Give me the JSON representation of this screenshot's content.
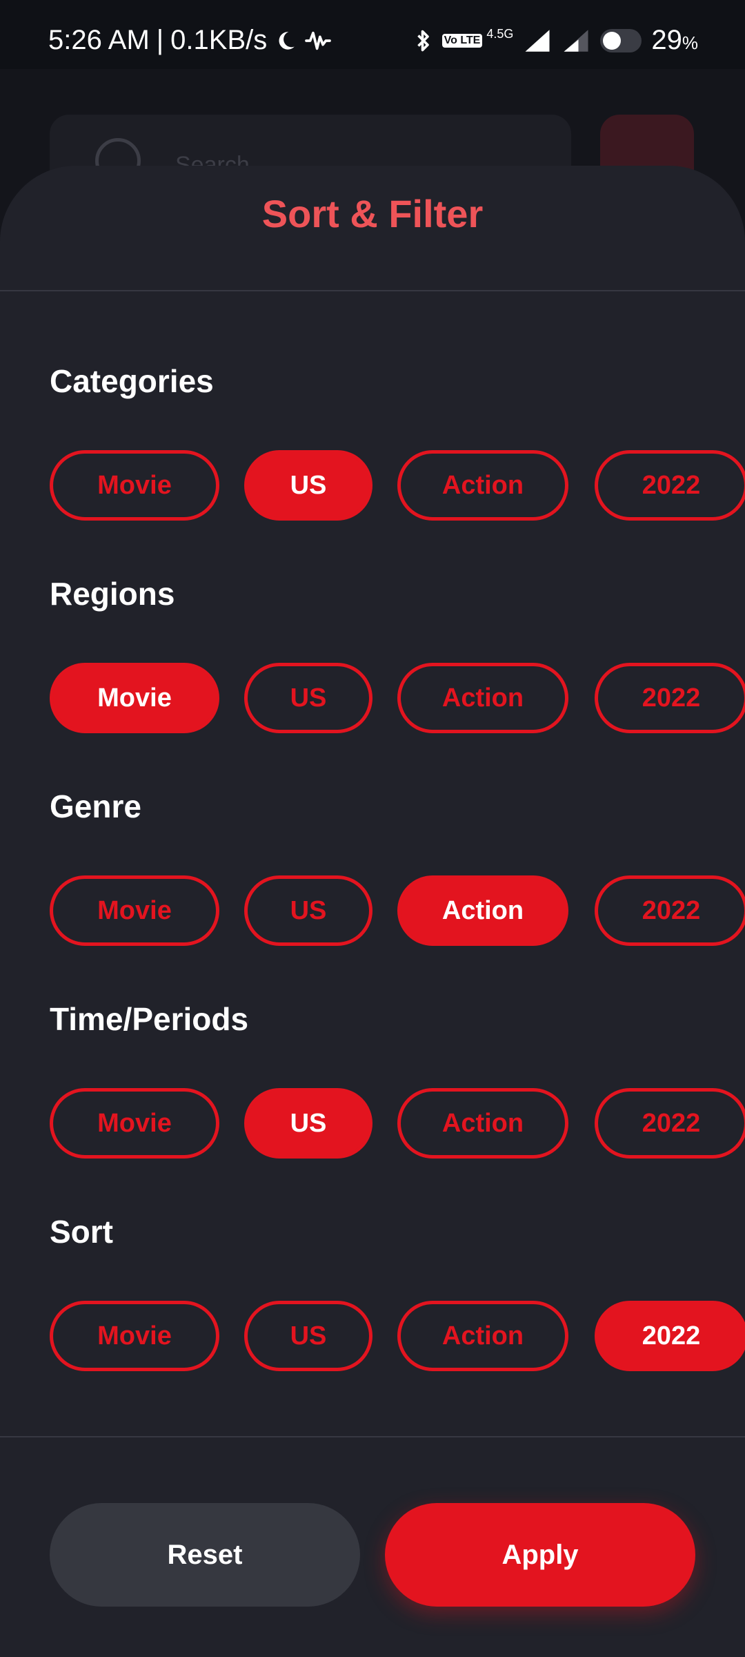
{
  "status_bar": {
    "time": "5:26 AM",
    "separator": "|",
    "net_speed": "0.1KB/s",
    "network_type": "4.5G",
    "volte": "Vo LTE",
    "battery": "29",
    "battery_unit": "%"
  },
  "background": {
    "search_placeholder": "Search"
  },
  "sheet": {
    "title": "Sort & Filter",
    "sections": [
      {
        "title": "Categories",
        "chips": [
          {
            "label": "Movie",
            "selected": false
          },
          {
            "label": "US",
            "selected": true
          },
          {
            "label": "Action",
            "selected": false
          },
          {
            "label": "2022",
            "selected": false
          }
        ]
      },
      {
        "title": "Regions",
        "chips": [
          {
            "label": "Movie",
            "selected": true
          },
          {
            "label": "US",
            "selected": false
          },
          {
            "label": "Action",
            "selected": false
          },
          {
            "label": "2022",
            "selected": false
          }
        ]
      },
      {
        "title": "Genre",
        "chips": [
          {
            "label": "Movie",
            "selected": false
          },
          {
            "label": "US",
            "selected": false
          },
          {
            "label": "Action",
            "selected": true
          },
          {
            "label": "2022",
            "selected": false
          }
        ]
      },
      {
        "title": "Time/Periods",
        "chips": [
          {
            "label": "Movie",
            "selected": false
          },
          {
            "label": "US",
            "selected": true
          },
          {
            "label": "Action",
            "selected": false
          },
          {
            "label": "2022",
            "selected": false
          }
        ]
      },
      {
        "title": "Sort",
        "chips": [
          {
            "label": "Movie",
            "selected": false
          },
          {
            "label": "US",
            "selected": false
          },
          {
            "label": "Action",
            "selected": false
          },
          {
            "label": "2022",
            "selected": true
          }
        ]
      }
    ],
    "reset_label": "Reset",
    "apply_label": "Apply"
  },
  "colors": {
    "accent": "#e3141f",
    "title": "#ee5458",
    "sheet_bg": "#21222a",
    "reset_bg": "#363840"
  },
  "icons": [
    "moon-icon",
    "activity-wave-icon",
    "bluetooth-icon",
    "volte-icon",
    "signal-icon",
    "signal-weak-icon",
    "toggle-icon",
    "search-icon",
    "filter-icon"
  ]
}
